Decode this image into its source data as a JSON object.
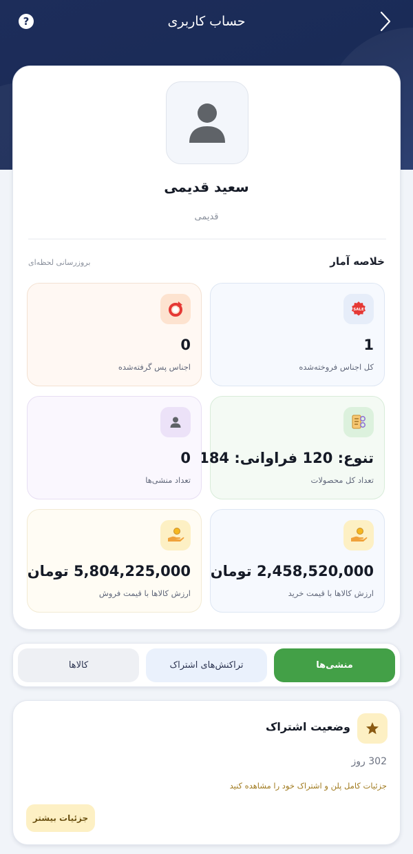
{
  "header": {
    "title": "حساب کاربری",
    "help_label": "?"
  },
  "profile": {
    "name": "سعید قدیمی",
    "role": "قدیمی"
  },
  "stats": {
    "title": "خلاصه آمار",
    "note": "بروزرسانی لحظه‌ای",
    "items": [
      {
        "value": "1",
        "label": "کل اجناس فروخته‌شده",
        "icon": "sale-tag-icon"
      },
      {
        "value": "0",
        "label": "اجناس پس گرفته‌شده",
        "icon": "return-icon"
      },
      {
        "value": "تنوع: 120 فراوانی: 184",
        "label": "تعداد کل محصولات",
        "icon": "product-list-icon"
      },
      {
        "value": "0",
        "label": "تعداد منشی‌ها",
        "icon": "user-icon"
      },
      {
        "value": "2,458,520,000 تومان",
        "label": "ارزش کالاها با قیمت خرید",
        "icon": "money-hand-icon"
      },
      {
        "value": "5,804,225,000 تومان",
        "label": "ارزش کالاها با قیمت فروش",
        "icon": "money-hand-icon"
      }
    ]
  },
  "tabs": [
    {
      "label": "منشی‌ها",
      "active": true
    },
    {
      "label": "تراکنش‌های اشتراک",
      "active": false
    },
    {
      "label": "کالاها",
      "active": false
    }
  ],
  "subscription": {
    "title": "وضعیت اشتراک",
    "days": "302 روز",
    "details_link": "جزئیات کامل پلن و اشتراک خود را مشاهده کنید",
    "more_button": "جزئیات بیشتر"
  },
  "colors": {
    "header_bg": "#1d2d5a",
    "accent_green": "#43a047",
    "gold": "#fdf0c4"
  }
}
